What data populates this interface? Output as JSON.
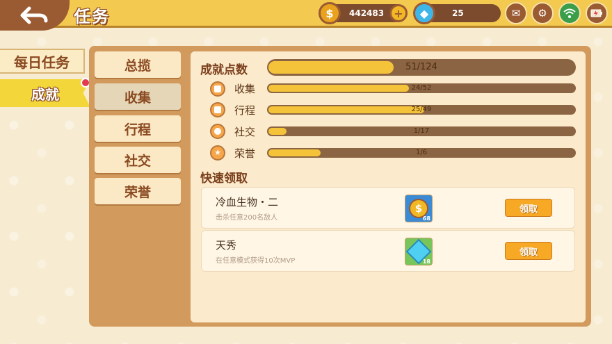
{
  "header": {
    "title": "任务",
    "coins": "442483",
    "gems": "25"
  },
  "left_tabs": [
    {
      "label": "每日任务"
    },
    {
      "label": "成就"
    }
  ],
  "categories": [
    {
      "label": "总揽"
    },
    {
      "label": "收集"
    },
    {
      "label": "行程"
    },
    {
      "label": "社交"
    },
    {
      "label": "荣誉"
    }
  ],
  "achievement": {
    "title": "成就点数",
    "total_text": "51/124",
    "total_progress": 0.41,
    "rows": [
      {
        "label": "收集",
        "text": "24/52",
        "progress": 0.46
      },
      {
        "label": "行程",
        "text": "25/49",
        "progress": 0.51
      },
      {
        "label": "社交",
        "text": "1/17",
        "progress": 0.06
      },
      {
        "label": "荣誉",
        "text": "1/6",
        "progress": 0.17
      }
    ]
  },
  "quick_claim": {
    "title": "快速领取",
    "quests": [
      {
        "name": "冷血生物・二",
        "desc": "击杀任意200名敌人",
        "reward_count": "68",
        "button": "领取",
        "reward_icon": "coin-icon"
      },
      {
        "name": "天秀",
        "desc": "在任意模式获得10次MVP",
        "reward_count": "18",
        "button": "领取",
        "reward_icon": "gem-icon"
      }
    ]
  },
  "colors": {
    "accent": "#f3c950",
    "brown": "#9a5a32",
    "bar": "#f5c33a"
  }
}
